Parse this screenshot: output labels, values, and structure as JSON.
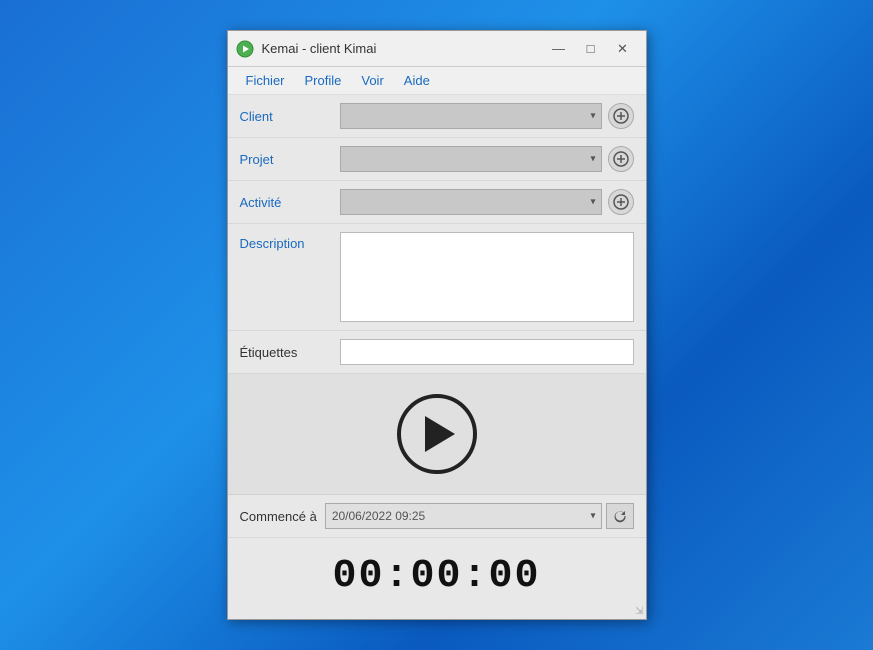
{
  "window": {
    "title": "Kemai - client Kimai",
    "icon": "▶"
  },
  "title_controls": {
    "minimize": "—",
    "maximize": "□",
    "close": "✕"
  },
  "menu": {
    "items": [
      "Fichier",
      "Profile",
      "Voir",
      "Aide"
    ]
  },
  "form": {
    "client_label": "Client",
    "projet_label": "Projet",
    "activite_label": "Activité",
    "description_label": "Description",
    "etiquettes_label": "Étiquettes",
    "client_placeholder": "",
    "projet_placeholder": "",
    "activite_placeholder": "",
    "description_placeholder": "",
    "etiquettes_placeholder": ""
  },
  "started": {
    "label": "Commencé à",
    "value": "20/06/2022 09:25"
  },
  "timer": {
    "display": "00:00:00"
  },
  "buttons": {
    "add_client": "+",
    "add_projet": "+",
    "add_activite": "+"
  }
}
